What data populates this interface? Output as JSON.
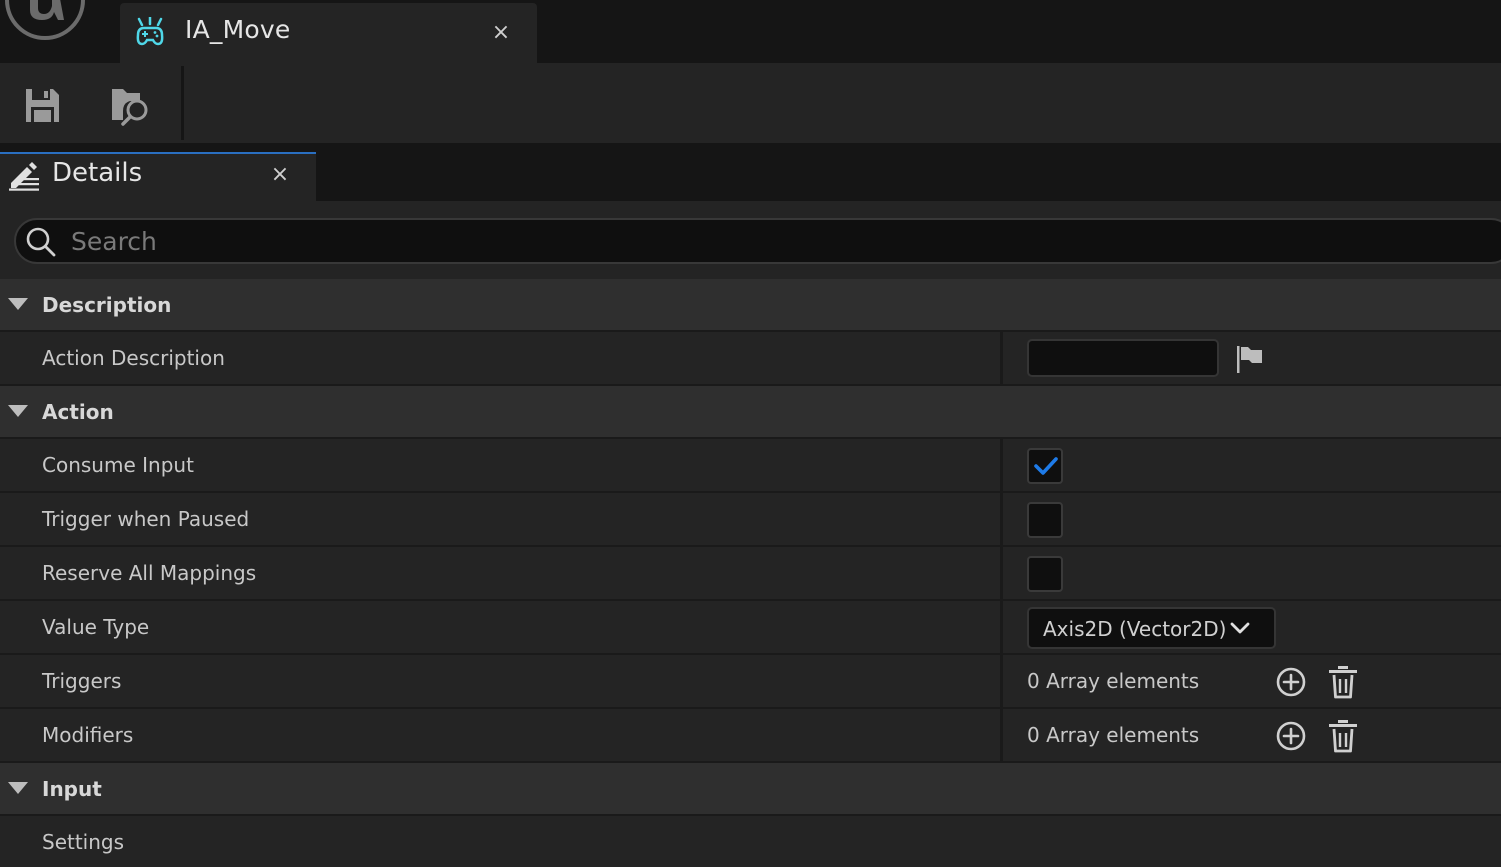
{
  "window": {
    "tab_title": "IA_Move",
    "tab_close": "×"
  },
  "panel": {
    "title": "Details",
    "close": "×"
  },
  "search": {
    "placeholder": "Search",
    "value": ""
  },
  "sections": {
    "description": {
      "label": "Description",
      "expanded": true,
      "action_description": {
        "label": "Action Description",
        "value": ""
      }
    },
    "action": {
      "label": "Action",
      "expanded": true,
      "consume_input": {
        "label": "Consume Input",
        "checked": true
      },
      "trigger_when_paused": {
        "label": "Trigger when Paused",
        "checked": false
      },
      "reserve_all_mappings": {
        "label": "Reserve All Mappings",
        "checked": false
      },
      "value_type": {
        "label": "Value Type",
        "value": "Axis2D (Vector2D)"
      },
      "triggers": {
        "label": "Triggers",
        "count_text": "0 Array elements"
      },
      "modifiers": {
        "label": "Modifiers",
        "count_text": "0 Array elements"
      }
    },
    "input": {
      "label": "Input",
      "expanded": true,
      "settings": {
        "label": "Settings",
        "expanded": false
      }
    }
  },
  "colors": {
    "accent_blue": "#2a6fc1",
    "checkmark_blue": "#1e7be8",
    "asset_icon_cyan": "#4fd7e8"
  },
  "icons": {
    "logo": "unreal-logo-icon",
    "asset": "input-action-icon",
    "save": "save-icon",
    "browse": "browse-content-icon",
    "details": "details-pencil-icon",
    "search": "search-icon",
    "flag": "localization-flag-icon",
    "add": "add-circle-icon",
    "delete": "trash-icon"
  }
}
